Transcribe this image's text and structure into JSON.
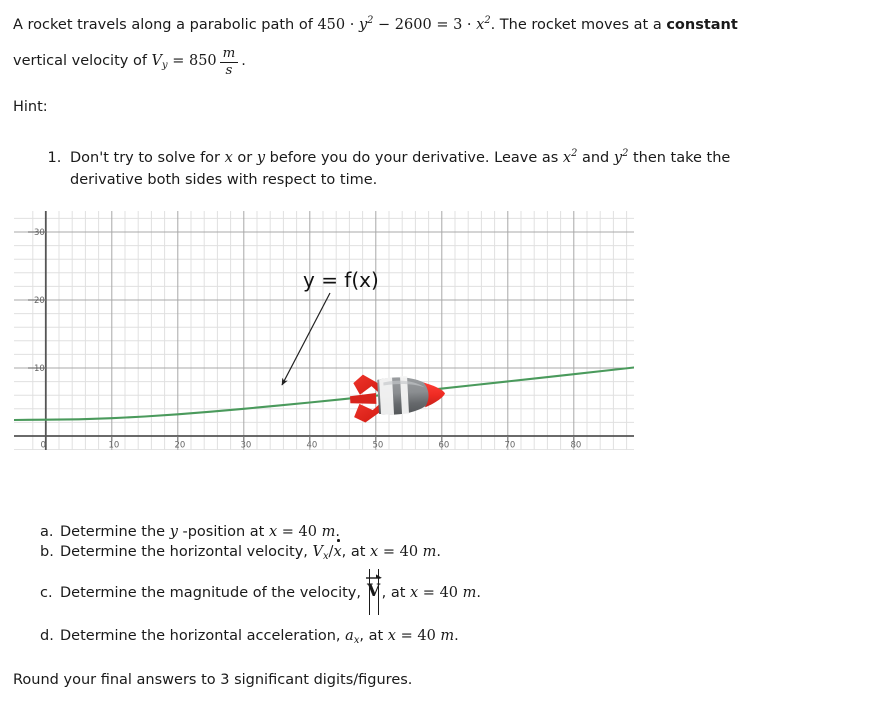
{
  "statement": {
    "line1_a": "A rocket travels along a parabolic path of ",
    "equation": {
      "coef_y": "450",
      "dot": "·",
      "var_y": "y",
      "exp_y": "2",
      "minus": "−",
      "const": "2600",
      "equals": "=",
      "coef_x": "3",
      "var_x": "x",
      "exp_x": "2"
    },
    "line1_b": ". The rocket moves at a ",
    "bold_constant": "constant",
    "line2_a": "vertical velocity of ",
    "vy_symbol": "V",
    "vy_sub": "y",
    "vy_equals": "=",
    "vy_value": "850",
    "vy_unit_num": "m",
    "vy_unit_den": "s",
    "line2_end": "."
  },
  "hint": {
    "label": "Hint:",
    "items": [
      {
        "part_a": "Don't try to solve for ",
        "var1": "x",
        "part_b": " or ",
        "var2": "y",
        "part_c": " before you do your derivative. Leave as ",
        "sq1_base": "x",
        "sq1_exp": "2",
        "part_d": " and ",
        "sq2_base": "y",
        "sq2_exp": "2",
        "part_e": " then take the",
        "line2": "derivative both sides with respect to time."
      }
    ]
  },
  "chart_data": {
    "type": "line",
    "title": "",
    "curve_label": "y = f(x)",
    "xlabel": "",
    "ylabel": "",
    "xlim": [
      -2,
      88
    ],
    "ylim": [
      -3,
      32
    ],
    "x_ticks": [
      "0",
      "10",
      "20",
      "30",
      "40",
      "50",
      "60",
      "70",
      "80"
    ],
    "x_tick_values": [
      0,
      10,
      20,
      30,
      40,
      50,
      60,
      70,
      80
    ],
    "y_ticks": [
      "0",
      "10",
      "20",
      "30"
    ],
    "y_tick_values": [
      0,
      10,
      20,
      30
    ],
    "minor_grid_step": 2,
    "grid": true,
    "legend": "none",
    "curve_color": "#4a9a5c",
    "axis_color": "#5a5a5a",
    "major_grid_color": "#9a9a9a",
    "minor_grid_color": "#dddddd",
    "equation": "450*y^2 - 2600 = 3*x^2",
    "series": [
      {
        "name": "y = f(x)",
        "x": [
          0,
          5,
          10,
          15,
          20,
          25,
          30,
          35,
          40,
          45,
          50,
          55,
          60,
          65,
          70,
          75,
          80,
          85,
          88
        ],
        "y": [
          2.4,
          2.46,
          2.62,
          2.87,
          3.2,
          3.58,
          4.0,
          4.45,
          4.93,
          5.42,
          5.93,
          6.44,
          6.96,
          7.49,
          8.02,
          8.55,
          9.09,
          9.63,
          9.95
        ]
      }
    ],
    "annotations": [
      {
        "name": "curve-callout",
        "text": "y = f(x)",
        "text_x": 43,
        "text_y": 21.5,
        "arrow_from_x": 43.5,
        "arrow_from_y": 19.0,
        "arrow_to_x": 35.8,
        "arrow_to_y": 5.6,
        "color": "#222222"
      }
    ],
    "rocket": {
      "name": "rocket-marker",
      "center_x": 57.5,
      "center_y": 6.4,
      "body_color": "#7a7d80",
      "nose_color": "#ef2b24",
      "fin_color": "#e02b22",
      "band_color": "#f2f2f2",
      "heading": "right"
    }
  },
  "questions": [
    {
      "label": "a.",
      "p1": "Determine the ",
      "var": "y",
      "p2": " -position at ",
      "xsym": "x",
      "eq": " = ",
      "val": "40",
      "unit": "m",
      "end": "."
    },
    {
      "label": "b.",
      "p1": "Determine the horizontal velocity, ",
      "vsym": "V",
      "vsub": "x",
      "slash": "/",
      "dotvar": "x",
      "p2": ", at ",
      "xsym": "x",
      "eq": " = ",
      "val": "40",
      "unit": "m",
      "end": "."
    },
    {
      "label": "c.",
      "p1": "Determine the magnitude of the velocity, ",
      "vecsym": "V",
      "p2": ", at ",
      "xsym": "x",
      "eq": " = ",
      "val": "40",
      "unit": "m",
      "end": "."
    },
    {
      "label": "d.",
      "p1": "Determine the horizontal acceleration, ",
      "asym": "a",
      "asub": "x",
      "p2": ", at ",
      "xsym": "x",
      "eq": " = ",
      "val": "40",
      "unit": "m",
      "end": "."
    }
  ],
  "footer": {
    "text": "Round your final answers to 3 significant digits/figures."
  }
}
